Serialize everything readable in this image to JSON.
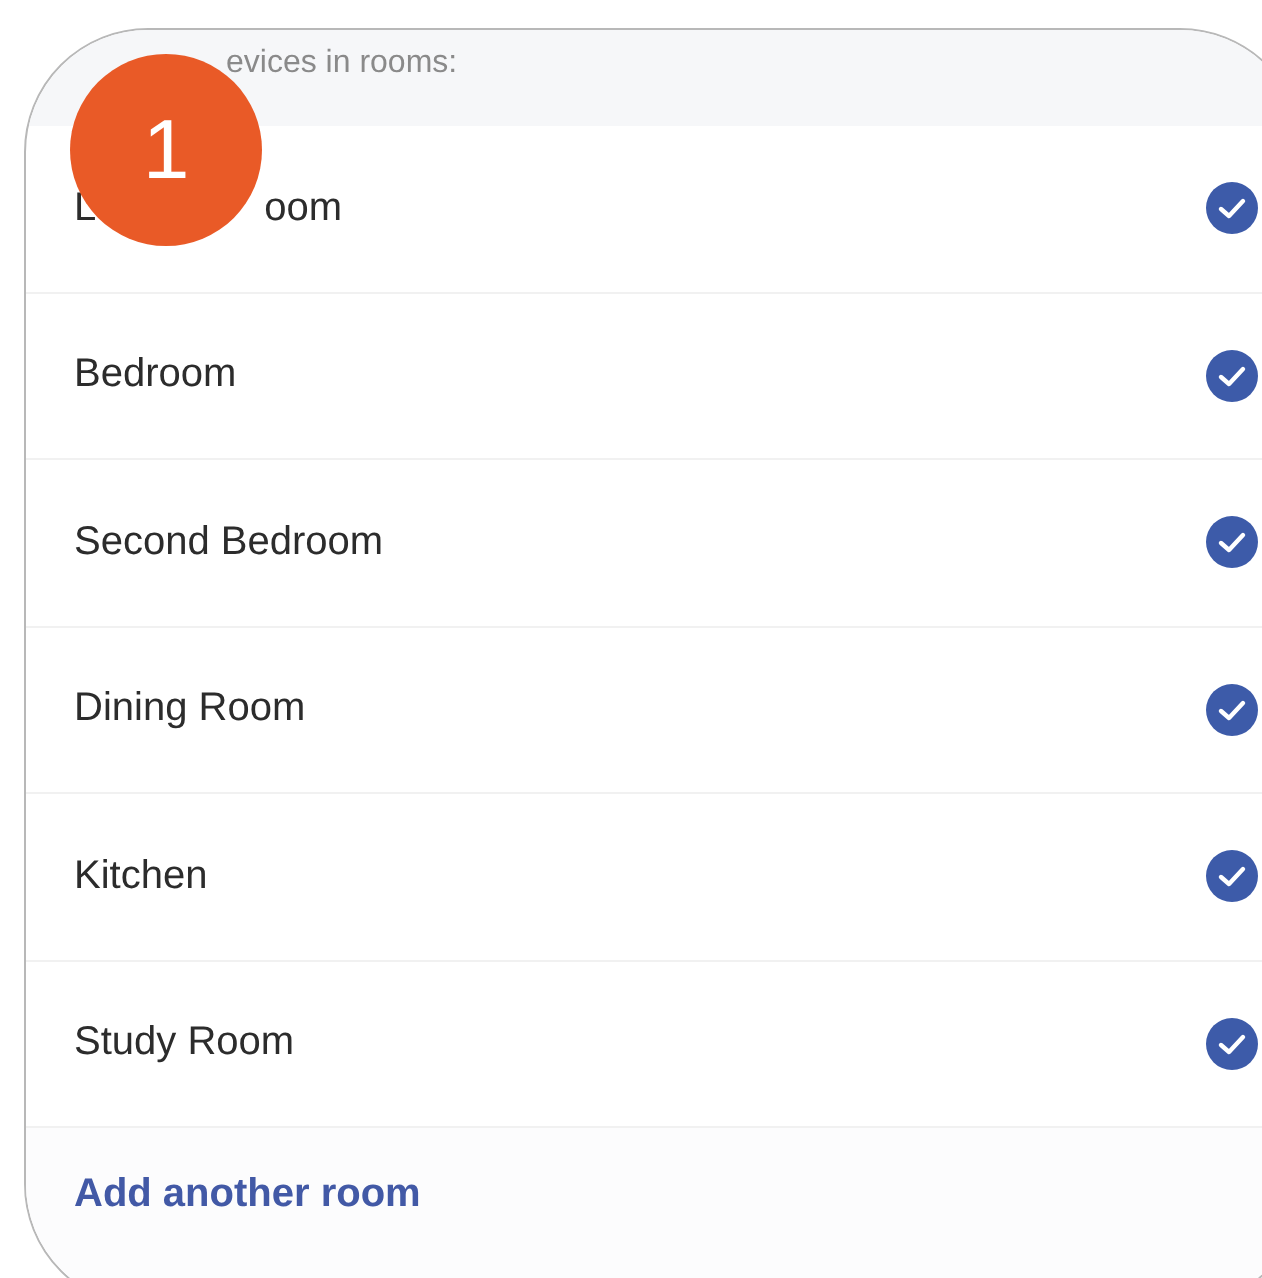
{
  "header": "evices in rooms:",
  "badge": "1",
  "rooms": [
    {
      "label_parts": [
        "L",
        "oom"
      ],
      "checked": true
    },
    {
      "label_parts": [
        "Bedroom"
      ],
      "checked": true
    },
    {
      "label_parts": [
        "Second Bedroom"
      ],
      "checked": true
    },
    {
      "label_parts": [
        "Dining Room"
      ],
      "checked": true
    },
    {
      "label_parts": [
        "Kitchen"
      ],
      "checked": true
    },
    {
      "label_parts": [
        "Study Room"
      ],
      "checked": true
    }
  ],
  "add_link": "Add another room"
}
